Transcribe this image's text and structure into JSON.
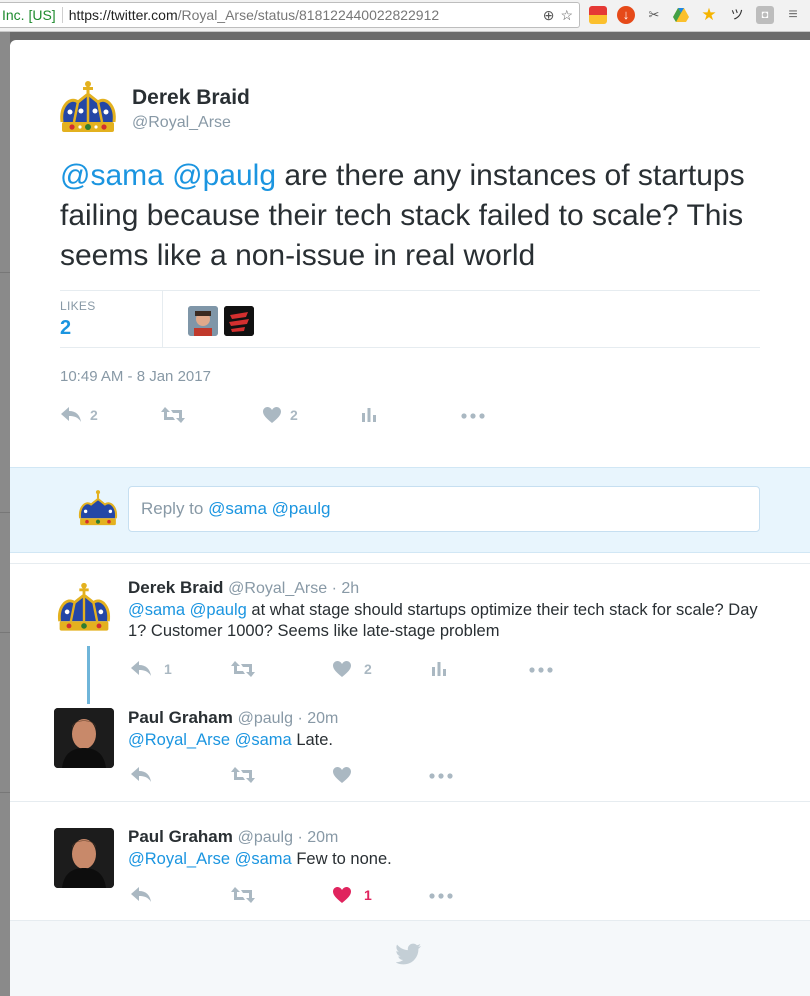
{
  "browser": {
    "secure_label": "Inc. [US]",
    "url_host": "https://twitter.com",
    "url_path": "/Royal_Arse/status/818122440022822912"
  },
  "main_tweet": {
    "author_name": "Derek Braid",
    "author_handle": "@Royal_Arse",
    "mention1": "@sama",
    "mention2": "@paulg",
    "text": " are there any instances of startups failing because their tech stack failed to scale? This seems like a non-issue in real world",
    "likes_label": "LIKES",
    "likes_count": "2",
    "timestamp": "10:49 AM - 8 Jan 2017",
    "reply_count": "2",
    "like_count": "2"
  },
  "reply_box": {
    "placeholder_prefix": "Reply to ",
    "placeholder_mentions": "@sama @paulg"
  },
  "replies": [
    {
      "name": "Derek Braid",
      "handle": "@Royal_Arse · 2h",
      "mentions": "@sama @paulg",
      "text": " at what stage should startups optimize their tech stack for scale? Day 1? Customer 1000? Seems like late-stage problem",
      "reply_count": "1",
      "like_count": "2"
    },
    {
      "name": "Paul Graham",
      "handle": "@paulg · 20m",
      "mentions": "@Royal_Arse @sama",
      "text": " Late."
    },
    {
      "name": "Paul Graham",
      "handle": "@paulg · 20m",
      "mentions": "@Royal_Arse @sama",
      "text": " Few to none.",
      "like_count": "1"
    }
  ],
  "colors": {
    "accent": "#1b95e0",
    "liked": "#e0245e",
    "icon": "#aab8c2"
  }
}
